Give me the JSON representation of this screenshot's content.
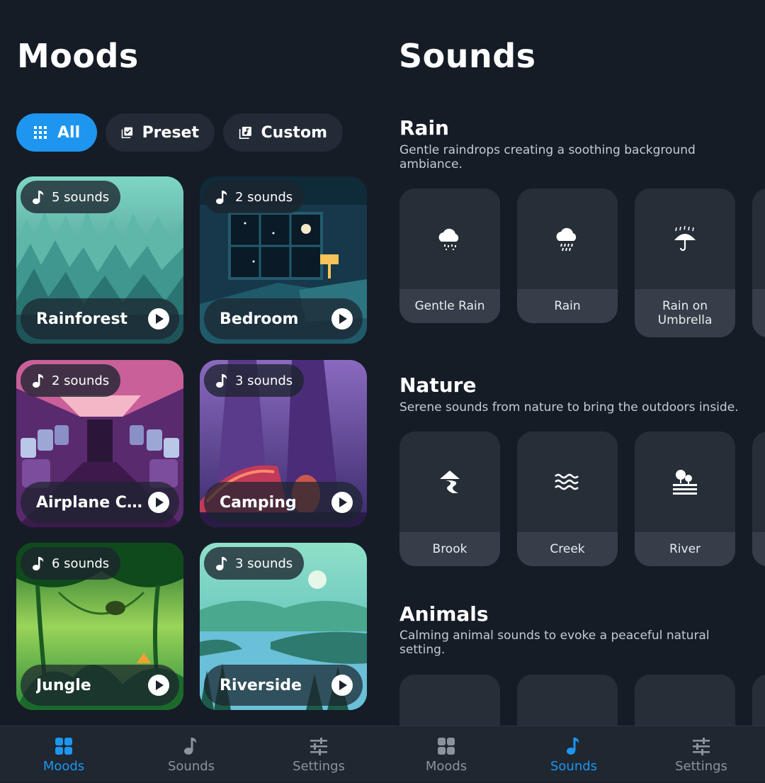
{
  "moods_pane": {
    "title": "Moods",
    "filters": [
      {
        "label": "All",
        "icon": "grid-icon",
        "active": true
      },
      {
        "label": "Preset",
        "icon": "checked-list-icon",
        "active": false
      },
      {
        "label": "Custom",
        "icon": "music-library-icon",
        "active": false
      }
    ],
    "moods": [
      {
        "name": "Rainforest",
        "sounds": "5 sounds"
      },
      {
        "name": "Bedroom",
        "sounds": "2 sounds"
      },
      {
        "name": "Airplane C...",
        "sounds": "2 sounds"
      },
      {
        "name": "Camping",
        "sounds": "3 sounds"
      },
      {
        "name": "Jungle",
        "sounds": "6 sounds"
      },
      {
        "name": "Riverside",
        "sounds": "3 sounds"
      }
    ]
  },
  "sounds_pane": {
    "title": "Sounds",
    "sections": [
      {
        "title": "Rain",
        "description": "Gentle raindrops creating a soothing background ambiance.",
        "tiles": [
          {
            "label": "Gentle Rain",
            "icon": "light-rain-cloud-icon"
          },
          {
            "label": "Rain",
            "icon": "rain-cloud-icon"
          },
          {
            "label": "Rain on Umbrella",
            "icon": "umbrella-rain-icon"
          }
        ]
      },
      {
        "title": "Nature",
        "description": "Serene sounds from nature to bring the outdoors inside.",
        "tiles": [
          {
            "label": "Brook",
            "icon": "brook-icon"
          },
          {
            "label": "Creek",
            "icon": "waves-icon"
          },
          {
            "label": "River",
            "icon": "river-trees-icon"
          }
        ]
      },
      {
        "title": "Animals",
        "description": "Calming animal sounds to evoke a peaceful natural setting.",
        "tiles": [
          {
            "label": "",
            "icon": "frog-icon"
          },
          {
            "label": "",
            "icon": "cricket-icon"
          },
          {
            "label": "",
            "icon": "bird-icon"
          }
        ]
      }
    ]
  },
  "bottom_nav": {
    "left": [
      {
        "label": "Moods",
        "icon": "moods-grid-icon",
        "active": true
      },
      {
        "label": "Sounds",
        "icon": "music-note-icon",
        "active": false
      },
      {
        "label": "Settings",
        "icon": "sliders-icon",
        "active": false
      }
    ],
    "right": [
      {
        "label": "Moods",
        "icon": "moods-grid-icon",
        "active": false
      },
      {
        "label": "Sounds",
        "icon": "music-note-icon",
        "active": true
      },
      {
        "label": "Settings",
        "icon": "sliders-icon",
        "active": false
      }
    ]
  },
  "colors": {
    "accent": "#1e96f0",
    "background": "#151c26",
    "surface": "#262e38"
  }
}
